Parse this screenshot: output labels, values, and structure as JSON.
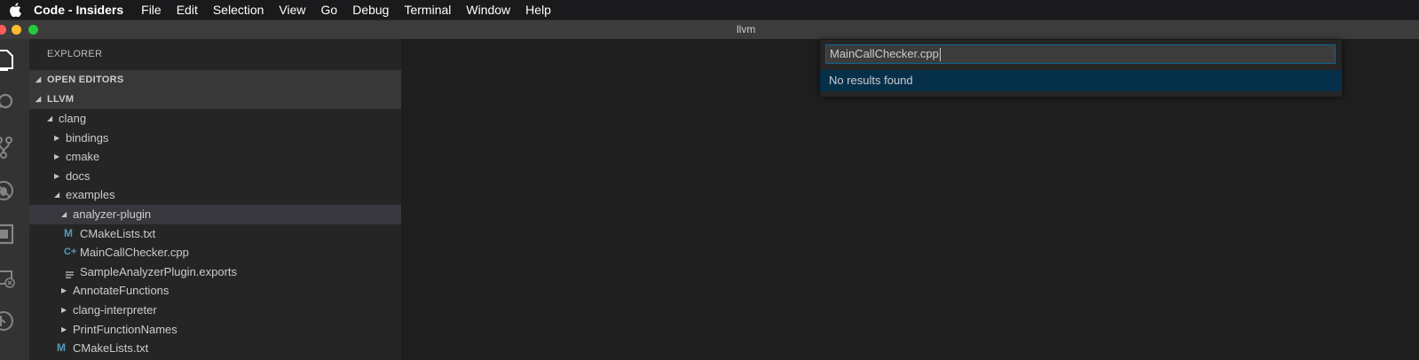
{
  "menubar": {
    "app_name": "Code - Insiders",
    "items": [
      "File",
      "Edit",
      "Selection",
      "View",
      "Go",
      "Debug",
      "Terminal",
      "Window",
      "Help"
    ]
  },
  "titlebar": {
    "title": "llvm"
  },
  "traffic_lights": {
    "close_color": "#fe5f57",
    "minimize_color": "#febc2e",
    "zoom_color": "#28c840"
  },
  "activity_bar": {
    "icons": [
      "explorer-icon",
      "search-icon",
      "source-control-icon",
      "debug-icon",
      "extensions-icon",
      "remote-explorer-icon",
      "gitlens-icon"
    ]
  },
  "sidebar": {
    "title": "EXPLORER",
    "sections": {
      "open_editors": "OPEN EDITORS",
      "workspace": "LLVM"
    },
    "tree": [
      {
        "label": "clang",
        "expanded": true,
        "type": "folder"
      },
      {
        "label": "bindings",
        "expanded": false,
        "type": "folder"
      },
      {
        "label": "cmake",
        "expanded": false,
        "type": "folder"
      },
      {
        "label": "docs",
        "expanded": false,
        "type": "folder"
      },
      {
        "label": "examples",
        "expanded": true,
        "type": "folder"
      },
      {
        "label": "analyzer-plugin",
        "expanded": true,
        "type": "folder",
        "selected": true
      },
      {
        "label": "CMakeLists.txt",
        "type": "file",
        "icon": "M"
      },
      {
        "label": "MainCallChecker.cpp",
        "type": "file",
        "icon": "C+"
      },
      {
        "label": "SampleAnalyzerPlugin.exports",
        "type": "file",
        "icon": "lines"
      },
      {
        "label": "AnnotateFunctions",
        "expanded": false,
        "type": "folder"
      },
      {
        "label": "clang-interpreter",
        "expanded": false,
        "type": "folder"
      },
      {
        "label": "PrintFunctionNames",
        "expanded": false,
        "type": "folder"
      },
      {
        "label": "CMakeLists.txt",
        "type": "file",
        "icon": "M"
      }
    ]
  },
  "quick_open": {
    "input_value": "MainCallChecker.cpp",
    "result": "No results found"
  },
  "colors": {
    "accent_focus": "#0e639c",
    "file_icon_cmake": "#519aba",
    "file_icon_cpp": "#519aba"
  }
}
